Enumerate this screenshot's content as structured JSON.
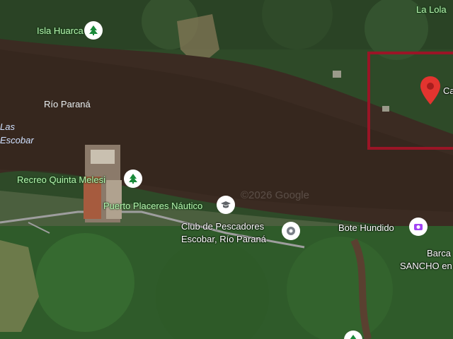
{
  "map": {
    "water_label": "Río Paraná",
    "edge_label_top": "Las",
    "edge_label_bottom": "Escobar",
    "top_right_label": "La Lola",
    "watermark": "©2026 Google",
    "colors": {
      "river": "#3a2a22",
      "forest": "#2b4a26",
      "selection_box": "#9a1526",
      "pin_red": "#e3342f"
    }
  },
  "places": [
    {
      "name": "Isla Huarca",
      "icon": "tree-icon"
    },
    {
      "name": "Recreo Quinta Melesi",
      "icon": "tree-icon"
    },
    {
      "name": "Puerto Placeres Náutico",
      "icon": "school-icon"
    },
    {
      "name_line1": "Club de Pescadores",
      "name_line2": "Escobar, Río Paraná",
      "icon": "location-icon"
    },
    {
      "name": "Bote Hundido",
      "icon": "camera-icon"
    },
    {
      "name_line1": "Barca",
      "name_line2": "SANCHO en",
      "icon": "none"
    },
    {
      "name": "Ca",
      "icon": "red-marker-icon"
    }
  ]
}
